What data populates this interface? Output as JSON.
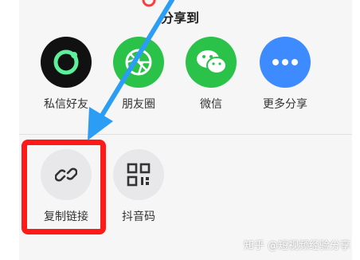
{
  "share_sheet": {
    "title": "分享到",
    "row1": [
      {
        "label": "私信好友",
        "icon": "private-message-icon",
        "color": "#111111"
      },
      {
        "label": "朋友圈",
        "icon": "wechat-moments-icon",
        "color": "#2bc24a"
      },
      {
        "label": "微信",
        "icon": "wechat-icon",
        "color": "#2bc24a"
      },
      {
        "label": "更多分享",
        "icon": "more-share-icon",
        "color": "#3d8bff"
      }
    ],
    "row2": [
      {
        "label": "复制链接",
        "icon": "link-icon",
        "color": "#e8e8ea"
      },
      {
        "label": "抖音码",
        "icon": "qrcode-icon",
        "color": "#e8e8ea"
      }
    ]
  },
  "annotations": {
    "arrow_color": "#2c9df4",
    "box_color": "#ff1a1a"
  },
  "watermark": "知乎 @短视频经验分享"
}
